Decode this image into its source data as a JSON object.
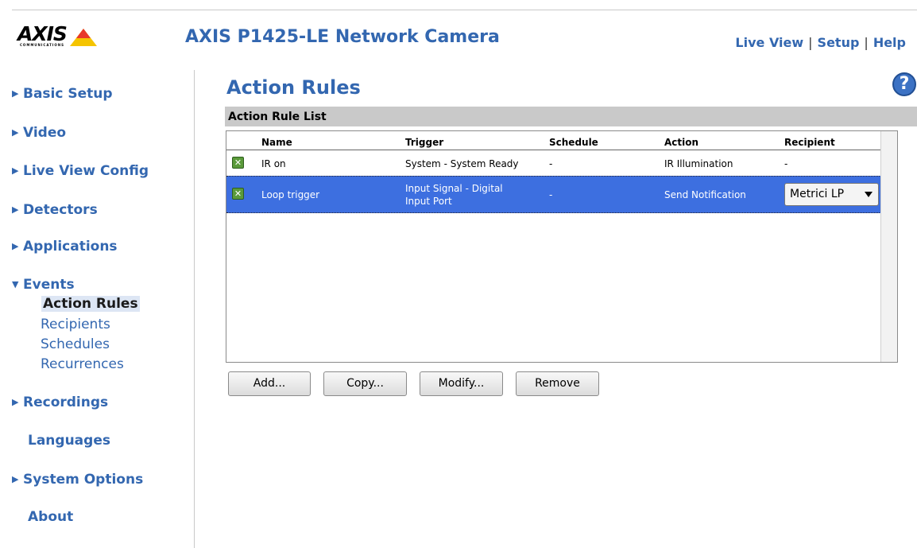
{
  "header": {
    "logo_text": "AXIS",
    "logo_sub": "COMMUNICATIONS",
    "title": "AXIS P1425-LE Network Camera",
    "links": [
      "Live View",
      "Setup",
      "Help"
    ],
    "separator": "|"
  },
  "sidebar": {
    "items": [
      {
        "label": "Basic Setup",
        "expandable": true
      },
      {
        "label": "Video",
        "expandable": true
      },
      {
        "label": "Live View Config",
        "expandable": true
      },
      {
        "label": "Detectors",
        "expandable": true
      },
      {
        "label": "Applications",
        "expandable": true
      },
      {
        "label": "Events",
        "expandable": true,
        "expanded": true
      },
      {
        "label": "Recordings",
        "expandable": true
      },
      {
        "label": "Languages",
        "expandable": false
      },
      {
        "label": "System Options",
        "expandable": true
      },
      {
        "label": "About",
        "expandable": false
      }
    ],
    "events_subitems": [
      "Action Rules",
      "Recipients",
      "Schedules",
      "Recurrences"
    ],
    "active_subitem": "Action Rules"
  },
  "main": {
    "page_title": "Action Rules",
    "help_icon": "question-mark-icon",
    "section_title": "Action Rule List",
    "table": {
      "columns": [
        "Name",
        "Trigger",
        "Schedule",
        "Action",
        "Recipient"
      ],
      "rows": [
        {
          "enabled": true,
          "name": "IR on",
          "trigger": "System - System Ready",
          "trigger_line2": "",
          "schedule": "-",
          "action": "IR Illumination",
          "recipient": "-",
          "selected": false
        },
        {
          "enabled": true,
          "name": "Loop trigger",
          "trigger": "Input Signal - Digital",
          "trigger_line2": "Input Port",
          "schedule": "-",
          "action": "Send Notification",
          "recipient": "Metrici LP",
          "selected": true
        }
      ]
    },
    "buttons": [
      "Add...",
      "Copy...",
      "Modify...",
      "Remove"
    ]
  },
  "colors": {
    "accent": "#3367b0",
    "selected_row": "#3d6fe0",
    "section_bar": "#c9c9c9",
    "checkbox": "#5a9a3a"
  }
}
